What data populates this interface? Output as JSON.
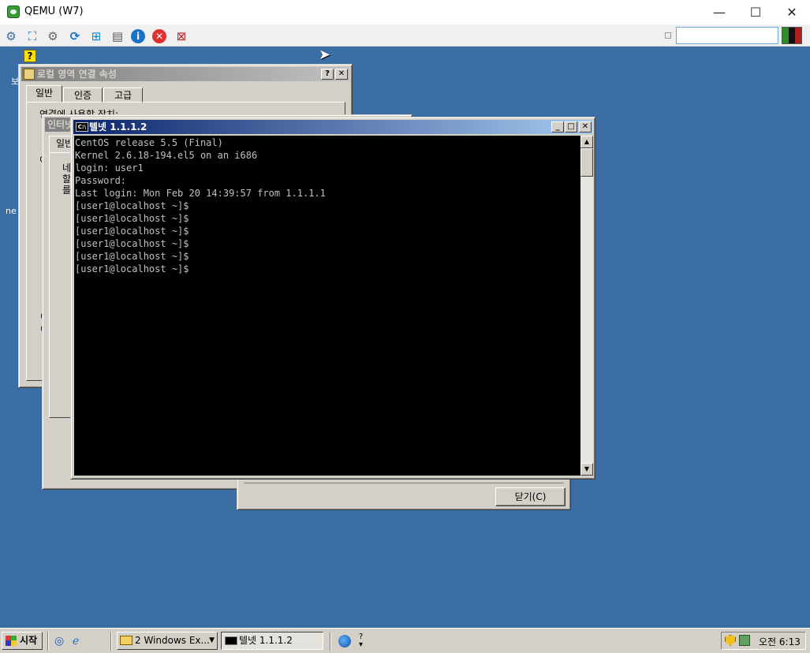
{
  "host": {
    "title": "QEMU (W7)",
    "controls": {
      "minimize": "—",
      "maximize": "☐",
      "close": "✕"
    }
  },
  "desktop": {
    "icon_label_1": "보",
    "icon_label_2": "ne"
  },
  "local_props": {
    "title": "로컬 영역 연결 속성",
    "tabs": [
      "일반",
      "인증",
      "고급"
    ],
    "fragment_1": "연결에 사용할 장치:",
    "fragment_2": "이",
    "fragment_3": "ㅁ",
    "fragment_4": "ㅁ"
  },
  "inet_props": {
    "title": "인터넷",
    "tab": "일반",
    "fragment_1": "네",
    "fragment_2": "할",
    "fragment_3": "를"
  },
  "status_dialog": {
    "close_button": "닫기(C)"
  },
  "telnet": {
    "title": "텔넷 1.1.1.2",
    "icon_text": "C:\\",
    "lines": [
      "CentOS release 5.5 (Final)",
      "Kernel 2.6.18-194.el5 on an i686",
      "login: user1",
      "Password:",
      "Last login: Mon Feb 20 14:39:57 from 1.1.1.1",
      "[user1@localhost ~]$",
      "[user1@localhost ~]$",
      "[user1@localhost ~]$",
      "[user1@localhost ~]$",
      "[user1@localhost ~]$",
      "[user1@localhost ~]$"
    ]
  },
  "taskbar": {
    "start_label": "시작",
    "explorer_group": "2 Windows Ex...",
    "telnet_task": "텔넷 1.1.1.2",
    "clock": "오전 6:13"
  },
  "colors": {
    "desktop": "#3a6ea5",
    "active_title_start": "#0a246a",
    "active_title_end": "#a6caf0",
    "face": "#d4d0c8"
  }
}
